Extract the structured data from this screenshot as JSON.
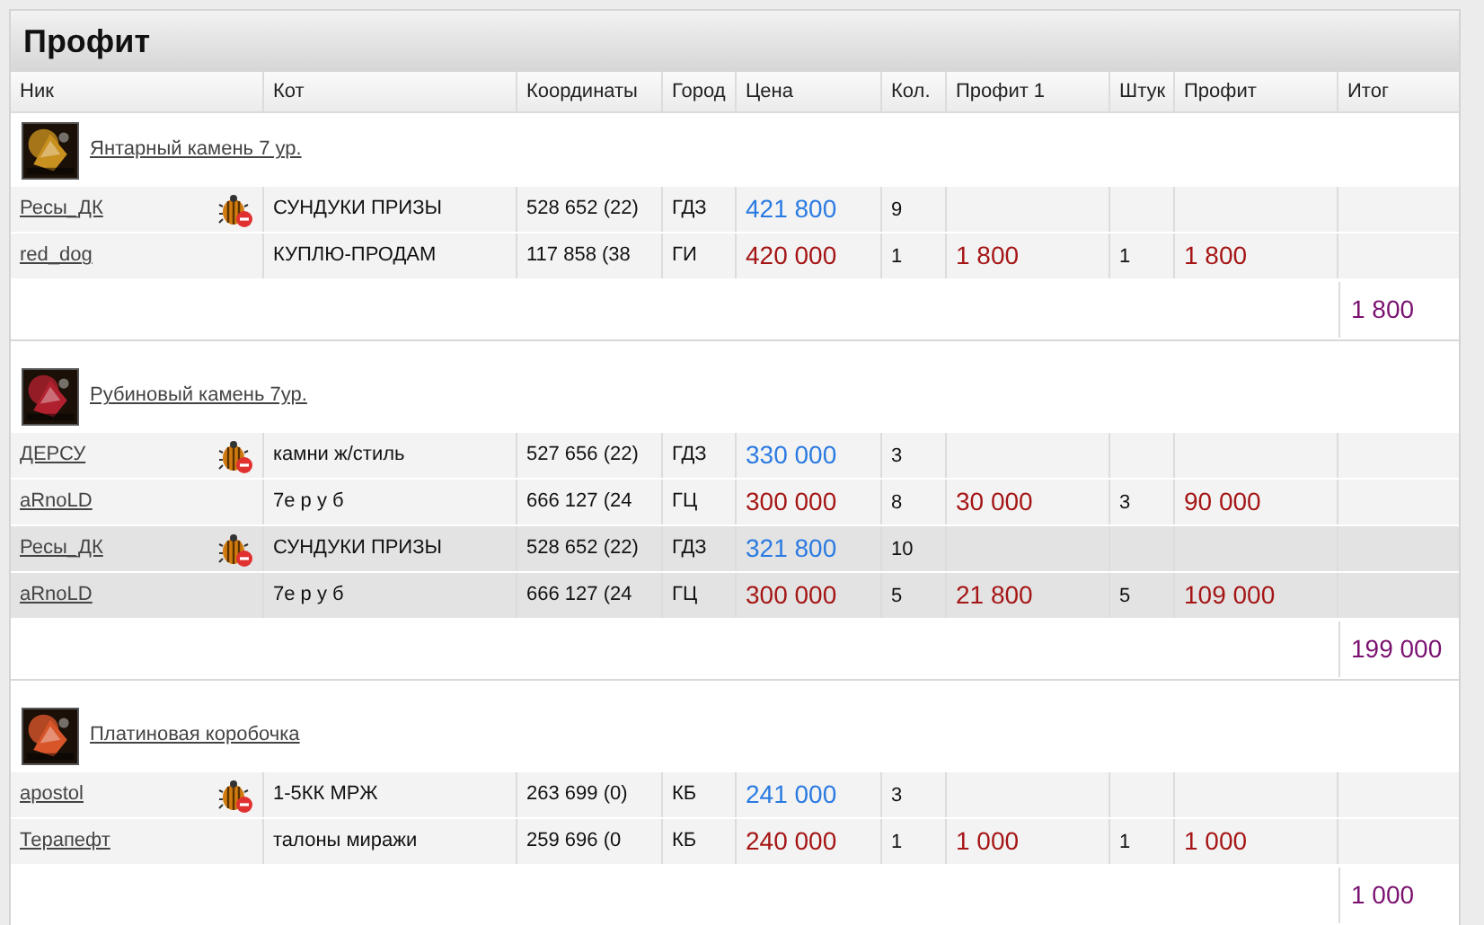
{
  "title": "Профит",
  "columns": [
    "Ник",
    "Кот",
    "Координаты",
    "Город",
    "Цена",
    "Кол.",
    "Профит 1",
    "Штук",
    "Профит",
    "Итог"
  ],
  "groups": [
    {
      "item": "Янтарный камень 7 ур.",
      "total": "1 800",
      "rows": [
        {
          "kind": "sell",
          "shaded": false,
          "nick": "Ресы_ДК",
          "cat": "СУНДУКИ ПРИЗЫ",
          "coords": "528 652 (22)",
          "city": "ГДЗ",
          "price": "421 800",
          "qty": "9"
        },
        {
          "kind": "buy",
          "shaded": false,
          "nick": "red_dog",
          "cat": "КУПЛЮ-ПРОДАМ",
          "coords": "117 858 (38",
          "city": "ГИ",
          "price": "420 000",
          "qty": "1",
          "profit1": "1 800",
          "pieces": "1",
          "profit": "1 800"
        }
      ]
    },
    {
      "item": "Рубиновый камень 7ур.",
      "total": "199 000",
      "rows": [
        {
          "kind": "sell",
          "shaded": false,
          "nick": "ДЕРСУ",
          "cat": "камни ж/стиль",
          "coords": "527 656 (22)",
          "city": "ГДЗ",
          "price": "330 000",
          "qty": "3"
        },
        {
          "kind": "buy",
          "shaded": false,
          "nick": "aRnoLD",
          "cat": "7е р у б",
          "coords": "666 127 (24",
          "city": "ГЦ",
          "price": "300 000",
          "qty": "8",
          "profit1": "30 000",
          "pieces": "3",
          "profit": "90 000"
        },
        {
          "kind": "sell",
          "shaded": true,
          "nick": "Ресы_ДК",
          "cat": "СУНДУКИ ПРИЗЫ",
          "coords": "528 652 (22)",
          "city": "ГДЗ",
          "price": "321 800",
          "qty": "10"
        },
        {
          "kind": "buy",
          "shaded": true,
          "nick": "aRnoLD",
          "cat": "7е р у б",
          "coords": "666 127 (24",
          "city": "ГЦ",
          "price": "300 000",
          "qty": "5",
          "profit1": "21 800",
          "pieces": "5",
          "profit": "109 000"
        }
      ]
    },
    {
      "item": "Платиновая коробочка",
      "total": "1 000",
      "rows": [
        {
          "kind": "sell",
          "shaded": false,
          "nick": "apostol",
          "cat": "1-5КК МРЖ",
          "coords": "263 699 (0)",
          "city": "КБ",
          "price": "241 000",
          "qty": "3"
        },
        {
          "kind": "buy",
          "shaded": false,
          "nick": "Терапефт",
          "cat": "талоны миражи",
          "coords": "259 696 (0",
          "city": "КБ",
          "price": "240 000",
          "qty": "1",
          "profit1": "1 000",
          "pieces": "1",
          "profit": "1 000"
        }
      ]
    }
  ]
}
